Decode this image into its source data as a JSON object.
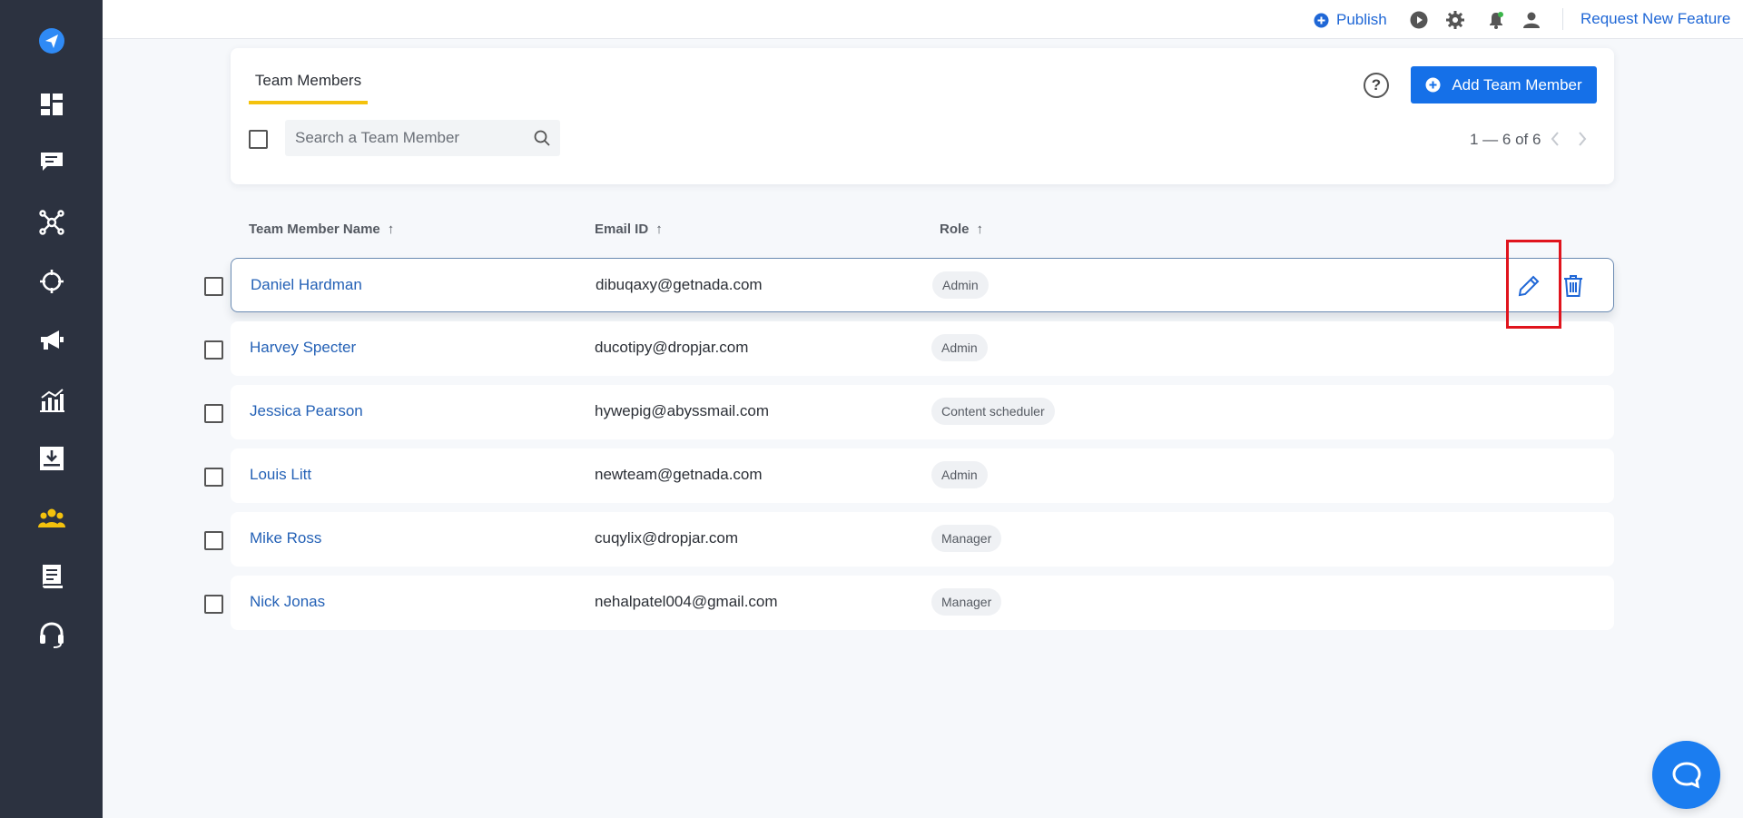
{
  "sidebar": {
    "items": [
      {
        "icon": "send-icon"
      },
      {
        "icon": "dashboard-icon"
      },
      {
        "icon": "chat-icon"
      },
      {
        "icon": "network-icon"
      },
      {
        "icon": "target-icon"
      },
      {
        "icon": "megaphone-icon"
      },
      {
        "icon": "analytics-icon"
      },
      {
        "icon": "download-icon"
      },
      {
        "icon": "team-icon",
        "active": true
      },
      {
        "icon": "document-icon"
      },
      {
        "icon": "headset-icon"
      }
    ]
  },
  "topbar": {
    "publish_label": "Publish",
    "request_label": "Request New Feature",
    "icons": [
      "play-icon",
      "gear-icon",
      "bell-icon",
      "user-icon"
    ]
  },
  "header": {
    "tab_label": "Team Members",
    "help_glyph": "?",
    "add_button_label": "Add Team Member",
    "search_placeholder": "Search a Team Member",
    "pagination": "1 — 6 of 6"
  },
  "table": {
    "columns": [
      {
        "label": "Team Member Name",
        "sort": "↑"
      },
      {
        "label": "Email ID",
        "sort": "↑"
      },
      {
        "label": "Role",
        "sort": "↑"
      }
    ],
    "rows": [
      {
        "name": "Daniel Hardman",
        "email": "dibuqaxy@getnada.com",
        "role": "Admin",
        "active": true
      },
      {
        "name": "Harvey Specter",
        "email": "ducotipy@dropjar.com",
        "role": "Admin"
      },
      {
        "name": "Jessica Pearson",
        "email": "hywepig@abyssmail.com",
        "role": "Content scheduler"
      },
      {
        "name": "Louis Litt",
        "email": "newteam@getnada.com",
        "role": "Admin"
      },
      {
        "name": "Mike Ross",
        "email": "cuqylix@dropjar.com",
        "role": "Manager"
      },
      {
        "name": "Nick Jonas",
        "email": "nehalpatel004@gmail.com",
        "role": "Manager"
      }
    ]
  },
  "colors": {
    "sidebar_bg": "#2c3240",
    "accent_blue": "#1570e8",
    "link_blue": "#2461b6",
    "tab_underline": "#f4c20d",
    "team_icon_active": "#f4c20d",
    "highlight_red": "#e0141d",
    "chat_blue": "#1b7df0"
  }
}
